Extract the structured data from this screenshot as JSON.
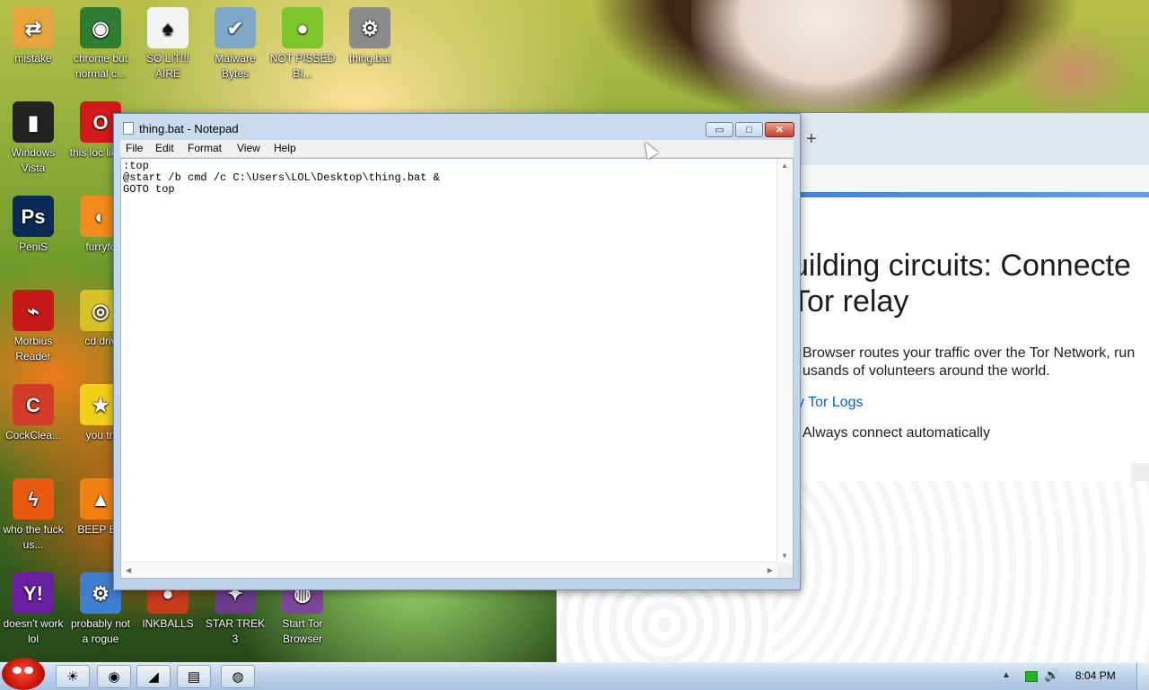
{
  "desktop": {
    "icons": [
      {
        "label": "mistake",
        "icon": "folder-sync-icon",
        "color": "#e7a33c"
      },
      {
        "label": "chrome but normal c...",
        "icon": "chrome-icon",
        "color": "#2e7d32"
      },
      {
        "label": "SO LIT!!! AIRE",
        "icon": "spade-card-icon",
        "color": "#f4f4f4"
      },
      {
        "label": "Malware Bytes",
        "icon": "shield-check-icon",
        "color": "#7fa7c8"
      },
      {
        "label": "NOT PISSED BI...",
        "icon": "green-pig-icon",
        "color": "#7cc52a"
      },
      {
        "label": "thing.bat",
        "icon": "gear-script-icon",
        "color": "#8a8a8a"
      },
      {
        "label": "Windows Vista",
        "icon": "trash-bin-icon",
        "color": "#222222"
      },
      {
        "label": "this loc like a",
        "icon": "opera-icon",
        "color": "#d21a1a"
      },
      {
        "label": "PeniS",
        "icon": "photoshop-icon",
        "color": "#0b2b57"
      },
      {
        "label": "furryfc",
        "icon": "firefox-icon",
        "color": "#f08a1b"
      },
      {
        "label": "Morbius Reader",
        "icon": "pdf-reader-icon",
        "color": "#c61a1a"
      },
      {
        "label": "cd driv",
        "icon": "cd-drive-icon",
        "color": "#d9c12a"
      },
      {
        "label": "CockClea...",
        "icon": "ccleaner-icon",
        "color": "#d43b2a"
      },
      {
        "label": "you tri",
        "icon": "star-icon",
        "color": "#f2cf1a"
      },
      {
        "label": "who the fuck us...",
        "icon": "lightning-icon",
        "color": "#e85a10"
      },
      {
        "label": "BEEP BE",
        "icon": "vlc-cone-icon",
        "color": "#f08010"
      },
      {
        "label": "doesn't work lol",
        "icon": "yahoo-messenger-icon",
        "color": "#6a1fa0"
      },
      {
        "label": "probably not a rogue",
        "icon": "computer-gears-icon",
        "color": "#3f7fd0"
      },
      {
        "label": "INKBALLS",
        "icon": "inkball-icon",
        "color": "#c83a1a"
      },
      {
        "label": "STAR TREK 3",
        "icon": "star-trek-icon",
        "color": "#6b3a8a"
      },
      {
        "label": "Start Tor Browser",
        "icon": "tor-onion-icon",
        "color": "#7d4698"
      }
    ]
  },
  "notepad": {
    "title": "thing.bat - Notepad",
    "menu": [
      "File",
      "Edit",
      "Format",
      "View",
      "Help"
    ],
    "content": ":top\n@start /b cmd /c C:\\Users\\LOL\\Desktop\\thing.bat &\nGOTO top",
    "min_label": "▭",
    "max_label": "□",
    "close_label": "✕"
  },
  "tor": {
    "new_tab": "+",
    "headline_line1": "uilding circuits: Connecte",
    "headline_line2": "Tor relay",
    "body_line1": "Browser routes your traffic over the Tor Network, run",
    "body_line2": "usands of volunteers around the world.",
    "logs_link": "y Tor Logs",
    "auto_connect": "Always connect automatically"
  },
  "taskbar": {
    "clock": "8:04 PM",
    "buttons": [
      {
        "icon": "explorer-icon",
        "glyph": "☀"
      },
      {
        "icon": "chrome-icon",
        "glyph": "◉"
      },
      {
        "icon": "media-player-icon",
        "glyph": "◢"
      },
      {
        "icon": "notepad-icon",
        "glyph": "▤"
      },
      {
        "icon": "tor-browser-icon",
        "glyph": "◍"
      }
    ],
    "tray_arrow": "▲",
    "volume": "🔊"
  }
}
